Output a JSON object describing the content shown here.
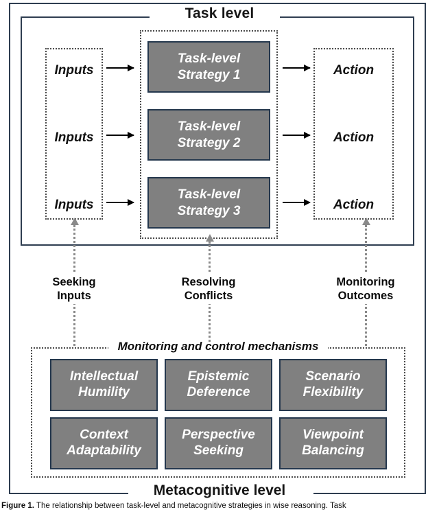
{
  "figure": {
    "task_level_title": "Task level",
    "metacognitive_level_title": "Metacognitive level",
    "mechanisms_title": "Monitoring and control mechanisms",
    "caption_label": "Figure 1.",
    "caption_text": "The relationship between task-level and metacognitive strategies in wise reasoning. Task",
    "colors": {
      "box_fill": "#808080",
      "box_border": "#24374d",
      "frame_border": "#2e3d50",
      "dotted_border": "#4a4a4a",
      "arrow": "#000000",
      "dotted_arrow": "#8a8a8a",
      "box_text": "#ffffff"
    }
  },
  "task_level": {
    "inputs": [
      {
        "label": "Inputs"
      },
      {
        "label": "Inputs"
      },
      {
        "label": "Inputs"
      }
    ],
    "strategies": [
      {
        "line1": "Task-level",
        "line2": "Strategy 1"
      },
      {
        "line1": "Task-level",
        "line2": "Strategy 2"
      },
      {
        "line1": "Task-level",
        "line2": "Strategy 3"
      }
    ],
    "actions": [
      {
        "label": "Action"
      },
      {
        "label": "Action"
      },
      {
        "label": "Action"
      }
    ]
  },
  "linking_processes": [
    {
      "line1": "Seeking",
      "line2": "Inputs"
    },
    {
      "line1": "Resolving",
      "line2": "Conflicts"
    },
    {
      "line1": "Monitoring",
      "line2": "Outcomes"
    }
  ],
  "mechanisms": [
    {
      "line1": "Intellectual",
      "line2": "Humility"
    },
    {
      "line1": "Epistemic",
      "line2": "Deference"
    },
    {
      "line1": "Scenario",
      "line2": "Flexibility"
    },
    {
      "line1": "Context",
      "line2": "Adaptability"
    },
    {
      "line1": "Perspective",
      "line2": "Seeking"
    },
    {
      "line1": "Viewpoint",
      "line2": "Balancing"
    }
  ]
}
